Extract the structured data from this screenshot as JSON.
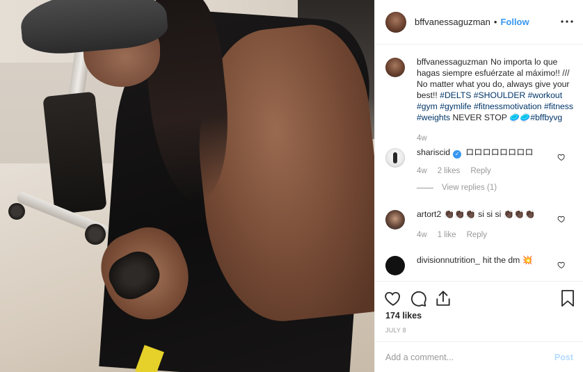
{
  "header": {
    "username": "bffvanessaguzman",
    "separator": "•",
    "follow_label": "Follow",
    "more_icon": "more-horizontal-icon"
  },
  "caption": {
    "username": "bffvanessaguzman",
    "text_plain_1": "No importa lo que hagas siempre esfuérzate al máximo!! /// No matter what you do, always give your best!! ",
    "hashtag_1": "#DELTS",
    "hashtag_2": "#SHOULDER",
    "hashtag_3": "#workout",
    "hashtag_4": "#gym",
    "hashtag_5": "#gymlife",
    "hashtag_6": "#fitnessmotivation",
    "hashtag_7": "#fitness",
    "hashtag_8": "#weights",
    "text_plain_2": "NEVER STOP 🥏🥏",
    "hashtag_9": "#bffbyvg",
    "time": "4w"
  },
  "comments": [
    {
      "username": "shariscid",
      "verified": true,
      "text": "ロロロロロロロロ",
      "time": "4w",
      "likes": "2 likes",
      "reply_label": "Reply",
      "view_replies": "View replies (1)"
    },
    {
      "username": "artort2",
      "text": "👏🏿👏🏿👏🏿 si si si 👏🏿👏🏿👏🏿",
      "time": "4w",
      "likes": "1 like",
      "reply_label": "Reply"
    },
    {
      "username": "divisionnutrition_",
      "text": "hit the dm 💥"
    }
  ],
  "actions": {
    "like_icon": "heart-icon",
    "comment_icon": "comment-icon",
    "share_icon": "share-icon",
    "save_icon": "bookmark-icon",
    "likes_count": "174 likes",
    "date": "JULY 8"
  },
  "comment_box": {
    "placeholder": "Add a comment...",
    "post_label": "Post"
  },
  "colors": {
    "link_blue": "#3897f0",
    "hashtag": "#003569",
    "meta_gray": "#999999",
    "post_disabled": "#b3dbff"
  }
}
